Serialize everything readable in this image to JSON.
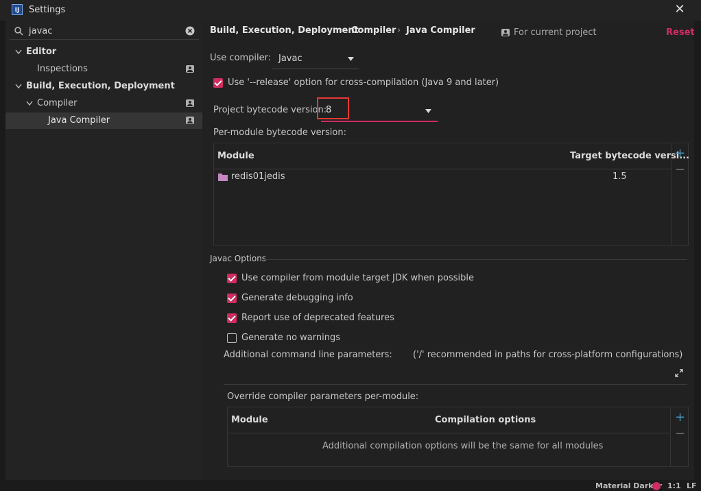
{
  "window": {
    "title": "Settings",
    "app_icon": "intellij-idea-logo",
    "logo_text": "IJ"
  },
  "search": {
    "value": "javac"
  },
  "sidebar": {
    "items": [
      {
        "label": "Editor"
      },
      {
        "label": "Inspections"
      },
      {
        "label": "Build, Execution, Deployment"
      },
      {
        "label": "Compiler"
      },
      {
        "label": "Java Compiler"
      }
    ]
  },
  "breadcrumb": {
    "items": [
      "Build, Execution, Deployment",
      "Compiler",
      "Java Compiler"
    ],
    "separator": "›"
  },
  "scope": {
    "label": "For current project"
  },
  "reset": {
    "label": "Reset"
  },
  "compiler": {
    "label": "Use compiler:",
    "value": "Javac"
  },
  "release_option": {
    "label": "Use '--release' option for cross-compilation (Java 9 and later)",
    "checked": true
  },
  "bytecode": {
    "label": "Project bytecode version:",
    "value": "8"
  },
  "per_module": {
    "label": "Per-module bytecode version:",
    "columns": [
      "Module",
      "Target bytecode versi..."
    ],
    "rows": [
      {
        "module": "redis01jedis",
        "target": "1.5"
      }
    ]
  },
  "javac_options": {
    "title": "Javac Options",
    "checks": [
      {
        "label": "Use compiler from module target JDK when possible",
        "checked": true
      },
      {
        "label": "Generate debugging info",
        "checked": true
      },
      {
        "label": "Report use of deprecated features",
        "checked": true
      },
      {
        "label": "Generate no warnings",
        "checked": false
      }
    ],
    "params_label": "Additional command line parameters:",
    "params_hint": "('/' recommended in paths for cross-platform configurations)"
  },
  "override": {
    "label": "Override compiler parameters per-module:",
    "columns": [
      "Module",
      "Compilation options"
    ],
    "empty_text": "Additional compilation options will be the same for all modules"
  },
  "background_status": {
    "theme": "Material Darker",
    "position": "1:1",
    "line_sep": "LF"
  },
  "colors": {
    "accent": "#d02c60",
    "highlight": "#e53935",
    "link": "#3d94c6"
  }
}
